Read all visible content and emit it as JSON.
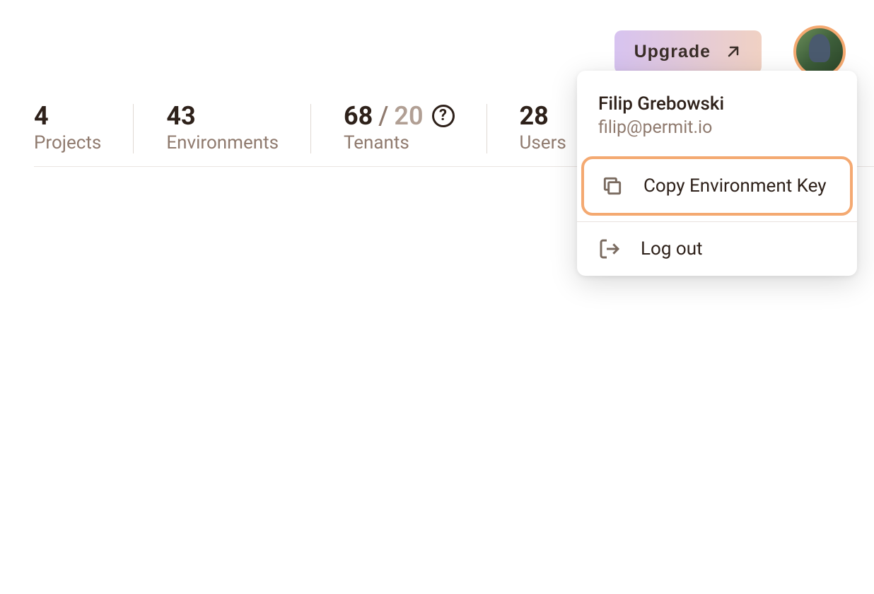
{
  "topbar": {
    "upgrade_label": "Upgrade"
  },
  "stats": [
    {
      "value": "4",
      "label": "Projects"
    },
    {
      "value": "43",
      "label": "Environments"
    },
    {
      "value": "68",
      "limit": "20",
      "label": "Tenants",
      "has_help": true
    },
    {
      "value": "28",
      "label": "Users"
    }
  ],
  "dropdown": {
    "user_name": "Filip Grebowski",
    "user_email": "filip@permit.io",
    "copy_env_label": "Copy Environment Key",
    "logout_label": "Log out"
  }
}
